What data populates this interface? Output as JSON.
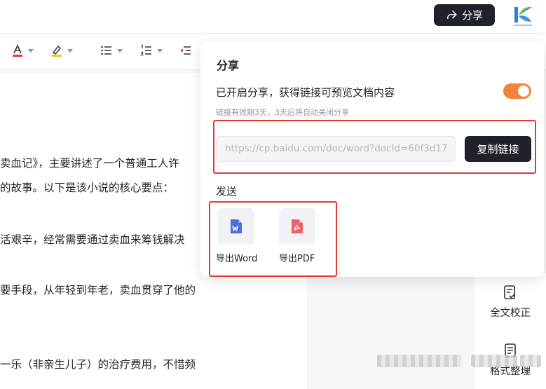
{
  "header": {
    "share_label": "分享"
  },
  "document": {
    "lines": [
      "卖血记》，主要讲述了一个普通工人许",
      "的故事。以下是该小说的核心要点：",
      "活艰辛，经常需要通过卖血来筹钱解决",
      "要手段，从年轻到年老，卖血贯穿了他的",
      "一乐（非亲生儿子）的治疗费用，不惜频"
    ]
  },
  "share_panel": {
    "title": "分享",
    "enabled_text": "已开启分享，获得链接可预览文档内容",
    "toggle_on": true,
    "expiry_hint": "链接有效期3天，3天后将自动关闭分享",
    "link_url": "https://cp.baidu.com/doc/word?docId=60f3d17",
    "copy_label": "复制链接",
    "send_label": "发送",
    "exports": [
      {
        "label": "导出Word",
        "icon": "word-icon",
        "color": "#4a6ee0"
      },
      {
        "label": "导出PDF",
        "icon": "pdf-icon",
        "color": "#f0616d"
      }
    ]
  },
  "side_panel": {
    "items": [
      {
        "label": "全文校正",
        "icon": "proofread-icon"
      },
      {
        "label": "格式整理",
        "icon": "format-icon"
      }
    ]
  },
  "colors": {
    "accent_dark": "#1f2329",
    "toggle_on": "#f5813b",
    "highlight": "#e53935"
  }
}
